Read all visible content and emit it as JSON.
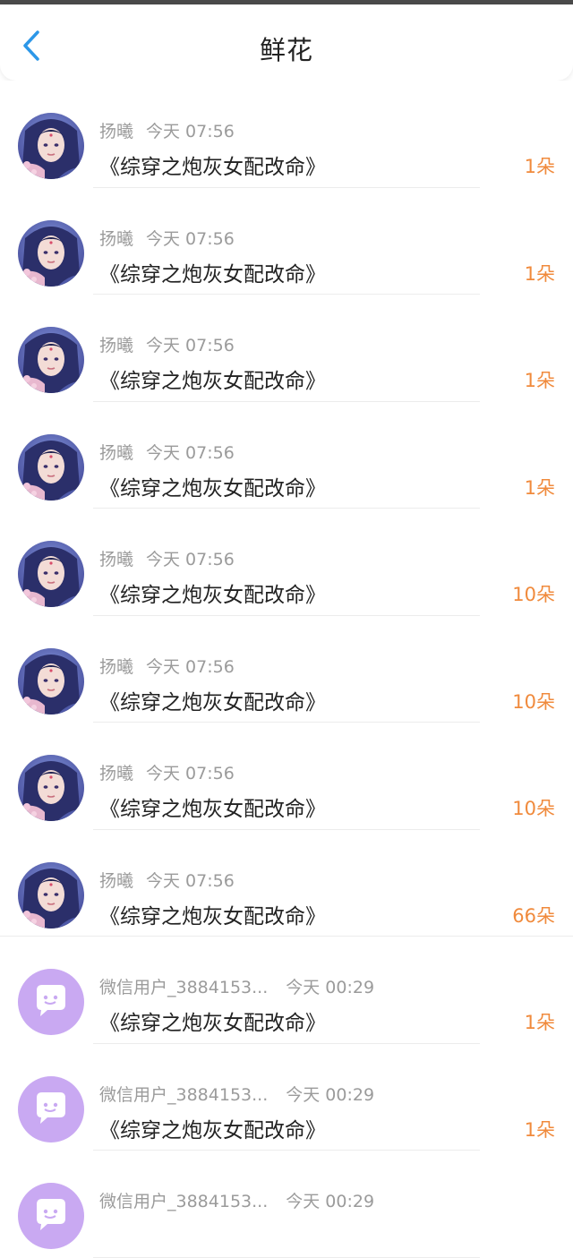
{
  "header": {
    "title": "鲜花"
  },
  "rows": [
    {
      "user": "扬曦",
      "time": "今天 07:56",
      "book": "《综穿之炮灰女配改命》",
      "count": "1朵",
      "avatar": "portrait"
    },
    {
      "user": "扬曦",
      "time": "今天 07:56",
      "book": "《综穿之炮灰女配改命》",
      "count": "1朵",
      "avatar": "portrait"
    },
    {
      "user": "扬曦",
      "time": "今天 07:56",
      "book": "《综穿之炮灰女配改命》",
      "count": "1朵",
      "avatar": "portrait"
    },
    {
      "user": "扬曦",
      "time": "今天 07:56",
      "book": "《综穿之炮灰女配改命》",
      "count": "1朵",
      "avatar": "portrait"
    },
    {
      "user": "扬曦",
      "time": "今天 07:56",
      "book": "《综穿之炮灰女配改命》",
      "count": "10朵",
      "avatar": "portrait"
    },
    {
      "user": "扬曦",
      "time": "今天 07:56",
      "book": "《综穿之炮灰女配改命》",
      "count": "10朵",
      "avatar": "portrait"
    },
    {
      "user": "扬曦",
      "time": "今天 07:56",
      "book": "《综穿之炮灰女配改命》",
      "count": "10朵",
      "avatar": "portrait"
    },
    {
      "user": "扬曦",
      "time": "今天 07:56",
      "book": "《综穿之炮灰女配改命》",
      "count": "66朵",
      "avatar": "portrait"
    },
    {
      "user": "微信用户_3884153...",
      "time": "今天 00:29",
      "book": "《综穿之炮灰女配改命》",
      "count": "1朵",
      "avatar": "wechat-default"
    },
    {
      "user": "微信用户_3884153...",
      "time": "今天 00:29",
      "book": "《综穿之炮灰女配改命》",
      "count": "1朵",
      "avatar": "wechat-default"
    },
    {
      "user": "微信用户_3884153...",
      "time": "今天 00:29",
      "book": "",
      "count": "",
      "avatar": "wechat-default"
    }
  ],
  "colors": {
    "accent": "#2c97e8",
    "count": "#f08a3c",
    "meta": "#9b9b9b",
    "wechat_avatar_bg": "#c9a9f2"
  }
}
